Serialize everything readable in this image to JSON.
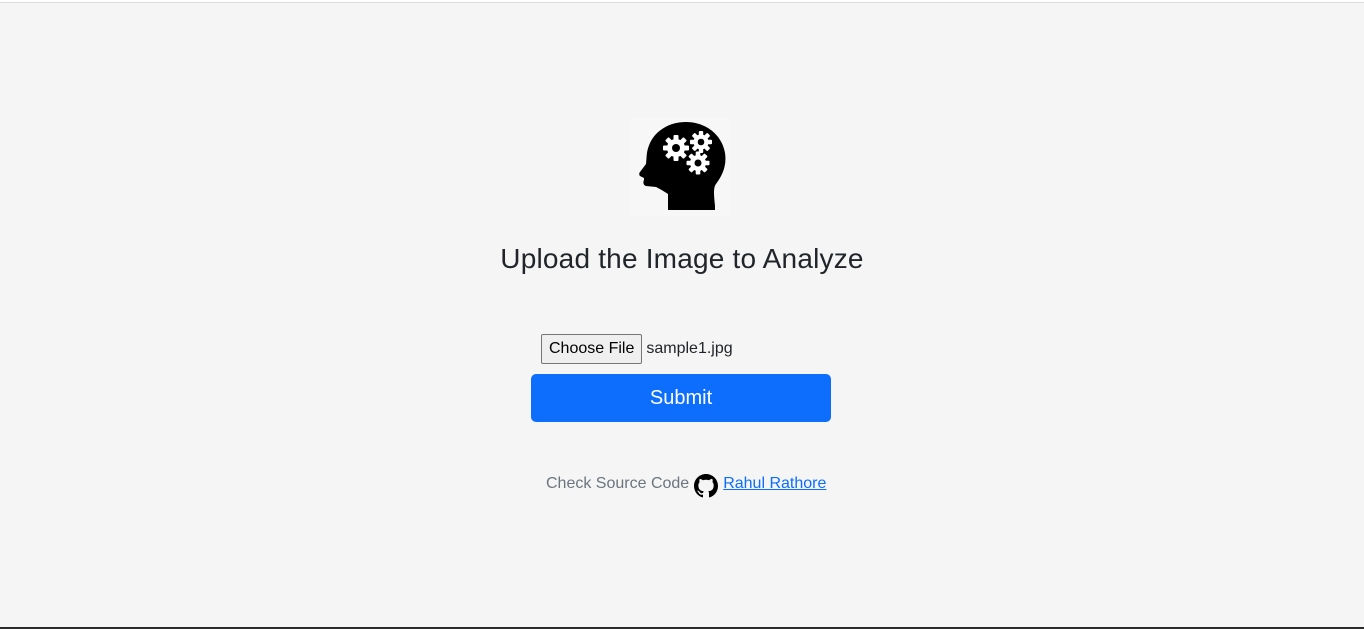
{
  "header": {
    "heading": "Upload the Image to Analyze"
  },
  "logo": {
    "icon": "head-gears-icon"
  },
  "upload": {
    "choose_label": "Choose File",
    "file_name": "sample1.jpg"
  },
  "submit": {
    "label": "Submit"
  },
  "footer": {
    "text": "Check Source Code",
    "icon": "github-icon",
    "link_label": "Rahul Rathore"
  },
  "colors": {
    "background": "#f5f5f5",
    "primary": "#0d6efd",
    "muted_text": "#6c757d"
  }
}
